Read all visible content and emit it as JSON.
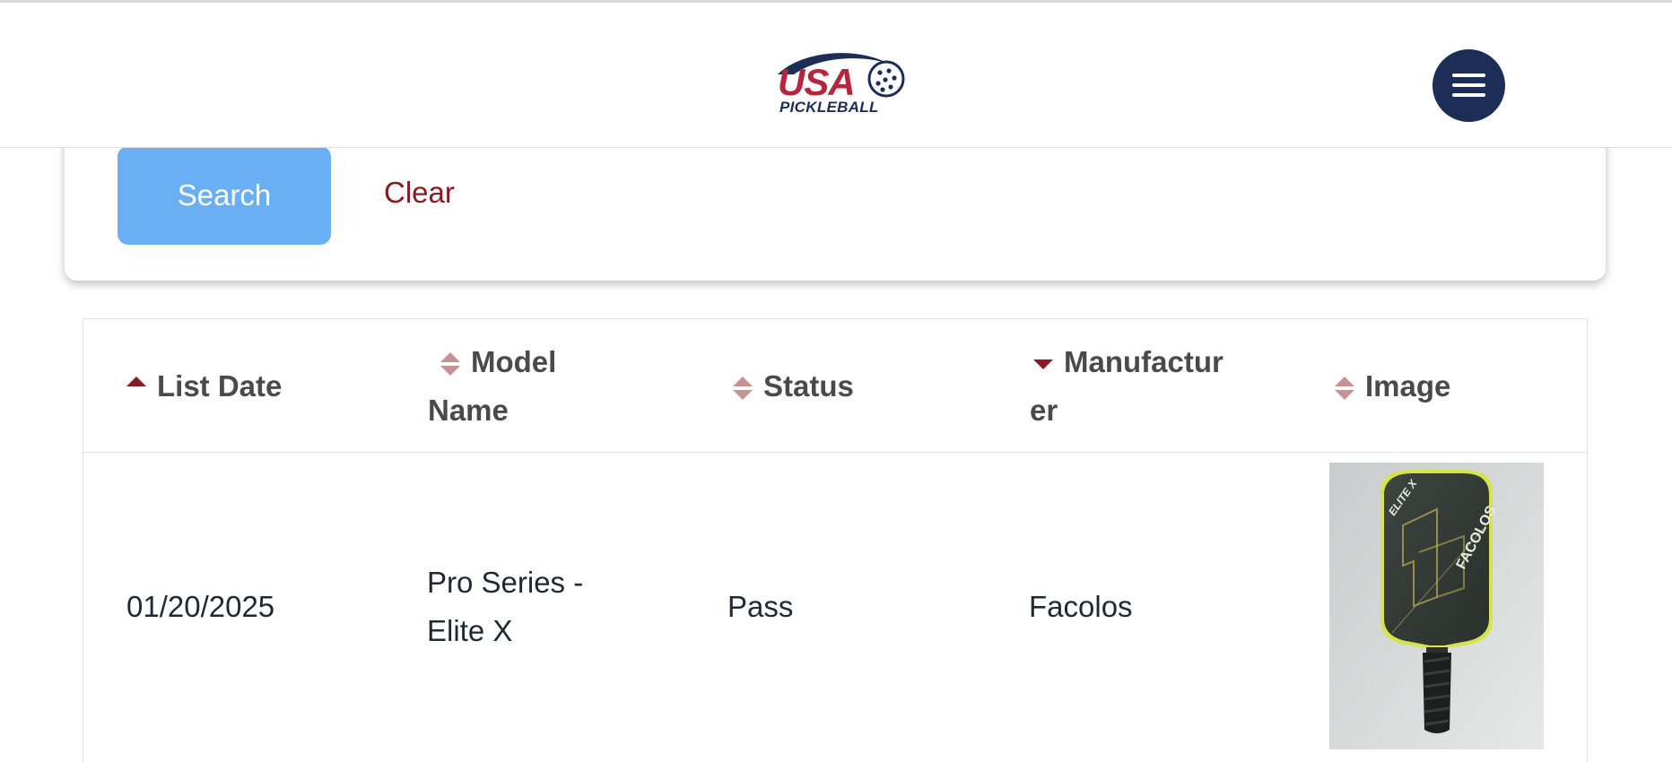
{
  "header": {
    "logo_usa": "USA",
    "logo_pickleball": "PICKLEBALL",
    "logo_trademark": ".",
    "menu_icon": "hamburger-menu-icon"
  },
  "search_panel": {
    "search_label": "Search",
    "clear_label": "Clear"
  },
  "table": {
    "columns": [
      {
        "label": "List Date",
        "sort": "asc"
      },
      {
        "label_line1": "Model",
        "label_line2": "Name",
        "sort": "none"
      },
      {
        "label": "Status",
        "sort": "none"
      },
      {
        "label_line1": "Manufactur",
        "label_line2": "er",
        "sort": "desc"
      },
      {
        "label": "Image",
        "sort": "none"
      }
    ],
    "rows": [
      {
        "list_date": "01/20/2025",
        "model_line1": "Pro Series -",
        "model_line2": "Elite X",
        "status": "Pass",
        "manufacturer": "Facolos",
        "image_brand": "FACOLOS",
        "image_model": "ELITE X"
      }
    ]
  },
  "colors": {
    "brand_navy": "#1c2d57",
    "brand_red": "#b3263c",
    "accent_maroon": "#8a1a21",
    "search_button": "#6aaef3"
  }
}
